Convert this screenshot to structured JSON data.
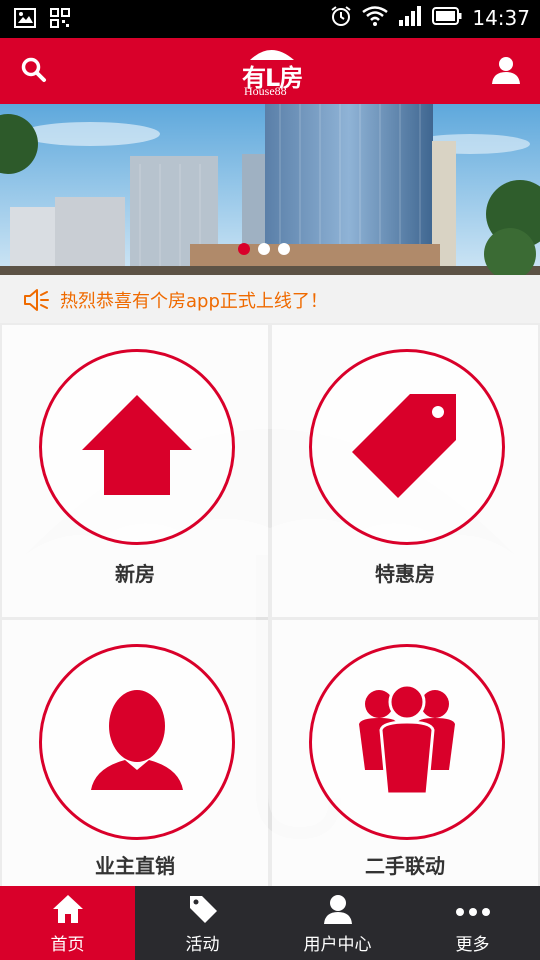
{
  "status_bar": {
    "time": "14:37"
  },
  "header": {
    "logo_cn": "有L房",
    "logo_en": "House88"
  },
  "banner": {
    "slide_count": 3,
    "active_slide": 1
  },
  "notice": {
    "text": "热烈恭喜有个房app正式上线了！"
  },
  "tiles": [
    {
      "label": "新房",
      "icon": "house-icon"
    },
    {
      "label": "特惠房",
      "icon": "price-tag-icon"
    },
    {
      "label": "业主直销",
      "icon": "person-icon"
    },
    {
      "label": "二手联动",
      "icon": "group-icon"
    }
  ],
  "bottom_nav": [
    {
      "label": "首页",
      "icon": "home-icon",
      "active": true
    },
    {
      "label": "活动",
      "icon": "tag-icon",
      "active": false
    },
    {
      "label": "用户中心",
      "icon": "user-icon",
      "active": false
    },
    {
      "label": "更多",
      "icon": "more-icon",
      "active": false
    }
  ],
  "colors": {
    "brand_red": "#d9002a",
    "notice_orange": "#ef6a00",
    "nav_dark": "#2a2a2e"
  }
}
